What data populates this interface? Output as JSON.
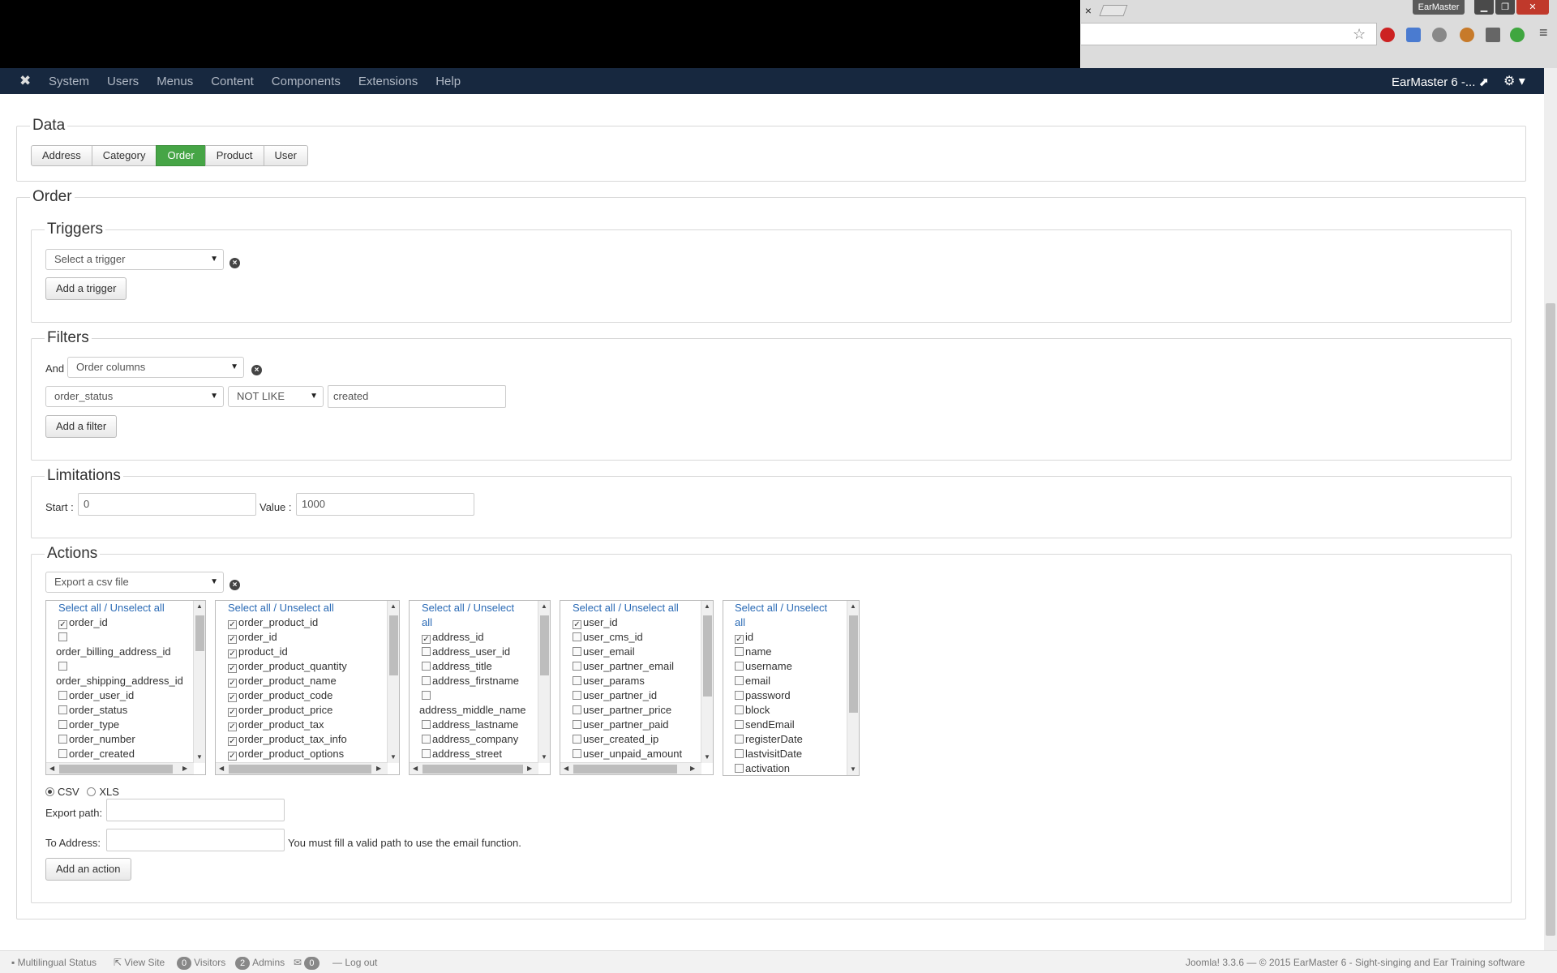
{
  "browser": {
    "tab_close": "×",
    "profile_label": "EarMaster",
    "window_buttons": [
      "▁",
      "❐",
      "✕"
    ],
    "star_icon": "☆",
    "menu_icon": "≡"
  },
  "navbar": {
    "logo": "✖",
    "menu": [
      "System",
      "Users",
      "Menus",
      "Content",
      "Components",
      "Extensions",
      "Help"
    ],
    "site_link": "EarMaster 6 -... ⬈",
    "settings_icon": "⚙ ▾"
  },
  "data_section": {
    "legend": "Data",
    "tabs": [
      "Address",
      "Category",
      "Order",
      "Product",
      "User"
    ],
    "active_tab": "Order"
  },
  "order_section": {
    "legend": "Order",
    "triggers": {
      "legend": "Triggers",
      "select_placeholder": "Select a trigger",
      "add_button": "Add a trigger"
    },
    "filters": {
      "legend": "Filters",
      "and_label": "And",
      "column_select": "Order columns",
      "field_select": "order_status",
      "operator_select": "NOT LIKE",
      "value": "created",
      "add_button": "Add a filter"
    },
    "limitations": {
      "legend": "Limitations",
      "start_label": "Start :",
      "start_value": "0",
      "value_label": "Value :",
      "value_value": "1000"
    },
    "actions": {
      "legend": "Actions",
      "select_value": "Export a csv file",
      "select_all": "Select all / Unselect all",
      "lists": [
        {
          "header": "Select all / Unselect all",
          "items": [
            {
              "label": "order_id",
              "checked": true
            },
            {
              "label": "order_billing_address_id",
              "checked": false
            },
            {
              "label": "order_shipping_address_id",
              "checked": false
            },
            {
              "label": "order_user_id",
              "checked": false
            },
            {
              "label": "order_status",
              "checked": false
            },
            {
              "label": "order_type",
              "checked": false
            },
            {
              "label": "order_number",
              "checked": false
            },
            {
              "label": "order_created",
              "checked": false
            }
          ]
        },
        {
          "header": "Select all / Unselect all",
          "items": [
            {
              "label": "order_product_id",
              "checked": true
            },
            {
              "label": "order_id",
              "checked": true
            },
            {
              "label": "product_id",
              "checked": true
            },
            {
              "label": "order_product_quantity",
              "checked": true
            },
            {
              "label": "order_product_name",
              "checked": true
            },
            {
              "label": "order_product_code",
              "checked": true
            },
            {
              "label": "order_product_price",
              "checked": true
            },
            {
              "label": "order_product_tax",
              "checked": true
            },
            {
              "label": "order_product_tax_info",
              "checked": true
            },
            {
              "label": "order_product_options",
              "checked": true
            }
          ]
        },
        {
          "header_line1": "Select all / Unselect",
          "header_line2": "all",
          "items": [
            {
              "label": "address_id",
              "checked": true
            },
            {
              "label": "address_user_id",
              "checked": false
            },
            {
              "label": "address_title",
              "checked": false
            },
            {
              "label": "address_firstname",
              "checked": false
            },
            {
              "label": "address_middle_name",
              "checked": false
            },
            {
              "label": "address_lastname",
              "checked": false
            },
            {
              "label": "address_company",
              "checked": false
            },
            {
              "label": "address_street",
              "checked": false
            }
          ]
        },
        {
          "header": "Select all / Unselect all",
          "items": [
            {
              "label": "user_id",
              "checked": true
            },
            {
              "label": "user_cms_id",
              "checked": false
            },
            {
              "label": "user_email",
              "checked": false
            },
            {
              "label": "user_partner_email",
              "checked": false
            },
            {
              "label": "user_params",
              "checked": false
            },
            {
              "label": "user_partner_id",
              "checked": false
            },
            {
              "label": "user_partner_price",
              "checked": false
            },
            {
              "label": "user_partner_paid",
              "checked": false
            },
            {
              "label": "user_created_ip",
              "checked": false
            },
            {
              "label": "user_unpaid_amount",
              "checked": false
            }
          ]
        },
        {
          "header_line1": "Select all / Unselect",
          "header_line2": "all",
          "items": [
            {
              "label": "id",
              "checked": true
            },
            {
              "label": "name",
              "checked": false
            },
            {
              "label": "username",
              "checked": false
            },
            {
              "label": "email",
              "checked": false
            },
            {
              "label": "password",
              "checked": false
            },
            {
              "label": "block",
              "checked": false
            },
            {
              "label": "sendEmail",
              "checked": false
            },
            {
              "label": "registerDate",
              "checked": false
            },
            {
              "label": "lastvisitDate",
              "checked": false
            },
            {
              "label": "activation",
              "checked": false
            }
          ]
        }
      ],
      "format_csv": "CSV",
      "format_xls": "XLS",
      "selected_format": "CSV",
      "export_path_label": "Export path:",
      "export_path_value": "",
      "to_address_label": "To Address:",
      "to_address_value": "",
      "email_hint": "You must fill a valid path to use the email function.",
      "add_button": "Add an action"
    }
  },
  "status_bar": {
    "multilingual": "Multilingual Status",
    "view_site": "View Site",
    "visitors_count": "0",
    "visitors_label": "Visitors",
    "admins_count": "2",
    "admins_label": "Admins",
    "messages_count": "0",
    "logout": "Log out",
    "version": "Joomla! 3.3.6",
    "copyright": "— © 2015 EarMaster 6 - Sight-singing and Ear Training software"
  },
  "colors": {
    "navbar_bg": "#17283f",
    "active_tab": "#46a546",
    "link_blue": "#2a6ab5"
  }
}
